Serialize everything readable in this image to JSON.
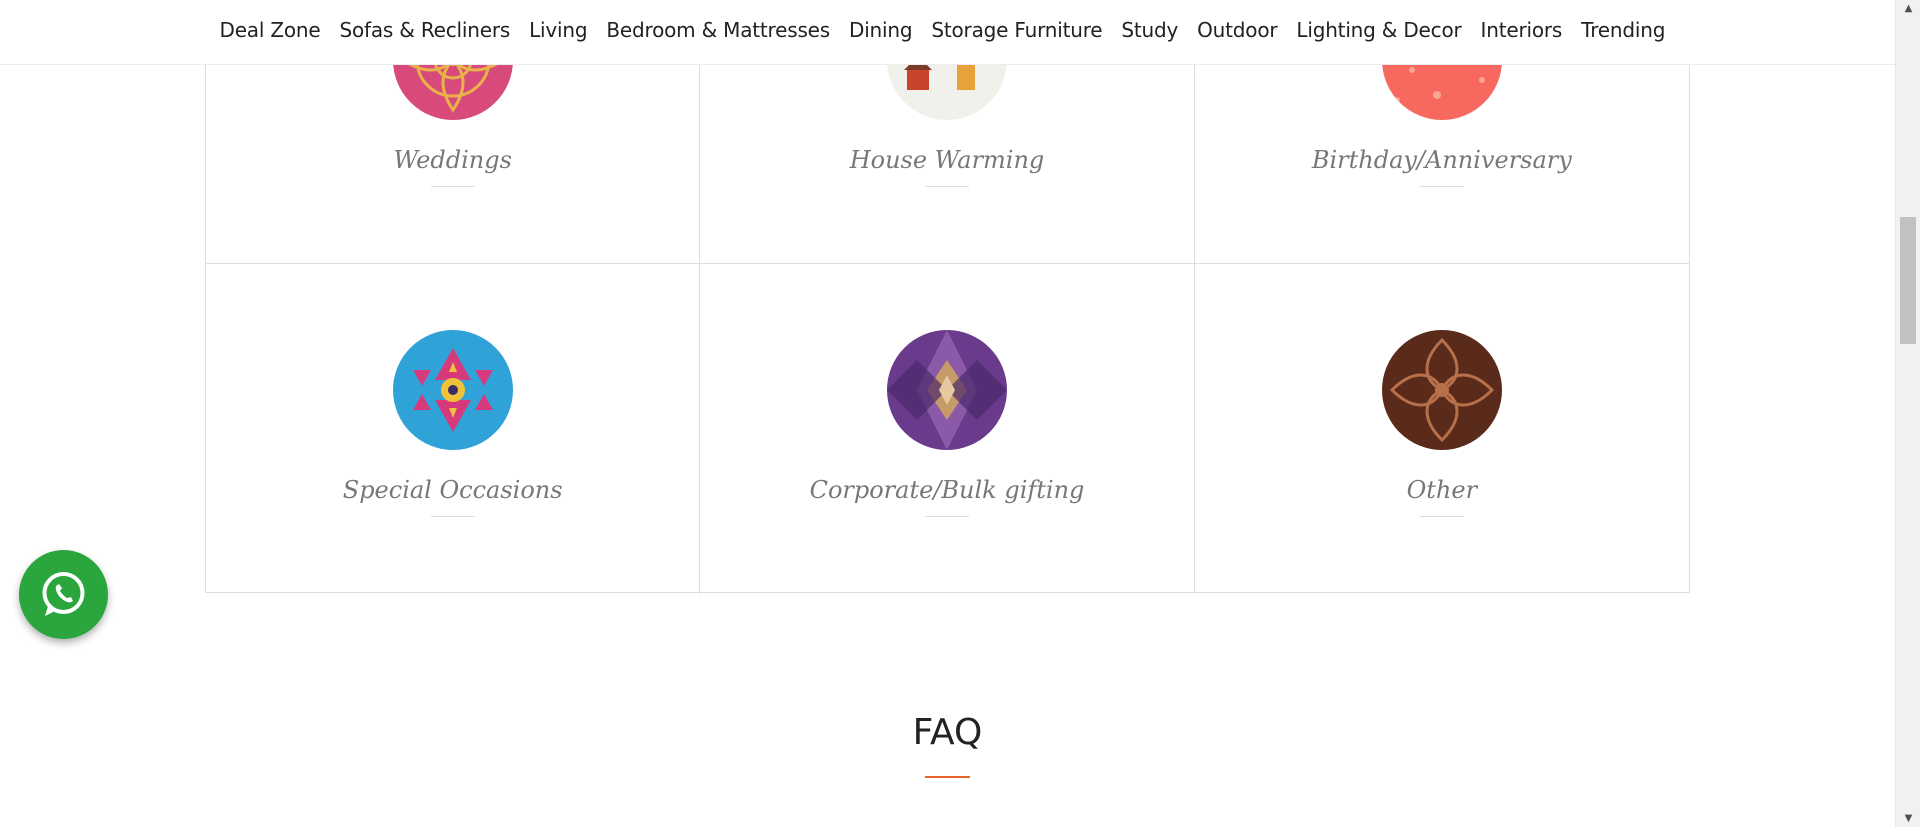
{
  "nav": {
    "items": [
      {
        "label": "Deal Zone"
      },
      {
        "label": "Sofas & Recliners"
      },
      {
        "label": "Living"
      },
      {
        "label": "Bedroom & Mattresses"
      },
      {
        "label": "Dining"
      },
      {
        "label": "Storage Furniture"
      },
      {
        "label": "Study"
      },
      {
        "label": "Outdoor"
      },
      {
        "label": "Lighting & Decor"
      },
      {
        "label": "Interiors"
      },
      {
        "label": "Trending"
      }
    ]
  },
  "occasions": [
    {
      "label": "Weddings",
      "colors": [
        "#d84a7c",
        "#e8b14a"
      ]
    },
    {
      "label": "House Warming",
      "colors": [
        "#f2f0ea",
        "#c8452b"
      ]
    },
    {
      "label": "Birthday/Anniversary",
      "colors": [
        "#f7685e",
        "#ffb3a0"
      ]
    },
    {
      "label": "Special Occasions",
      "colors": [
        "#2fa3d8",
        "#d63a7c"
      ]
    },
    {
      "label": "Corporate/Bulk gifting",
      "colors": [
        "#6a3a8c",
        "#c79a6a"
      ]
    },
    {
      "label": "Other",
      "colors": [
        "#5a2a1a",
        "#b8704a"
      ]
    }
  ],
  "faq": {
    "title": "FAQ",
    "accent": "#e8622a"
  },
  "whatsapp": {
    "icon": "whatsapp-icon",
    "color": "#2aa63d"
  },
  "scrollbar": {
    "up_glyph": "▲",
    "down_glyph": "▼"
  }
}
